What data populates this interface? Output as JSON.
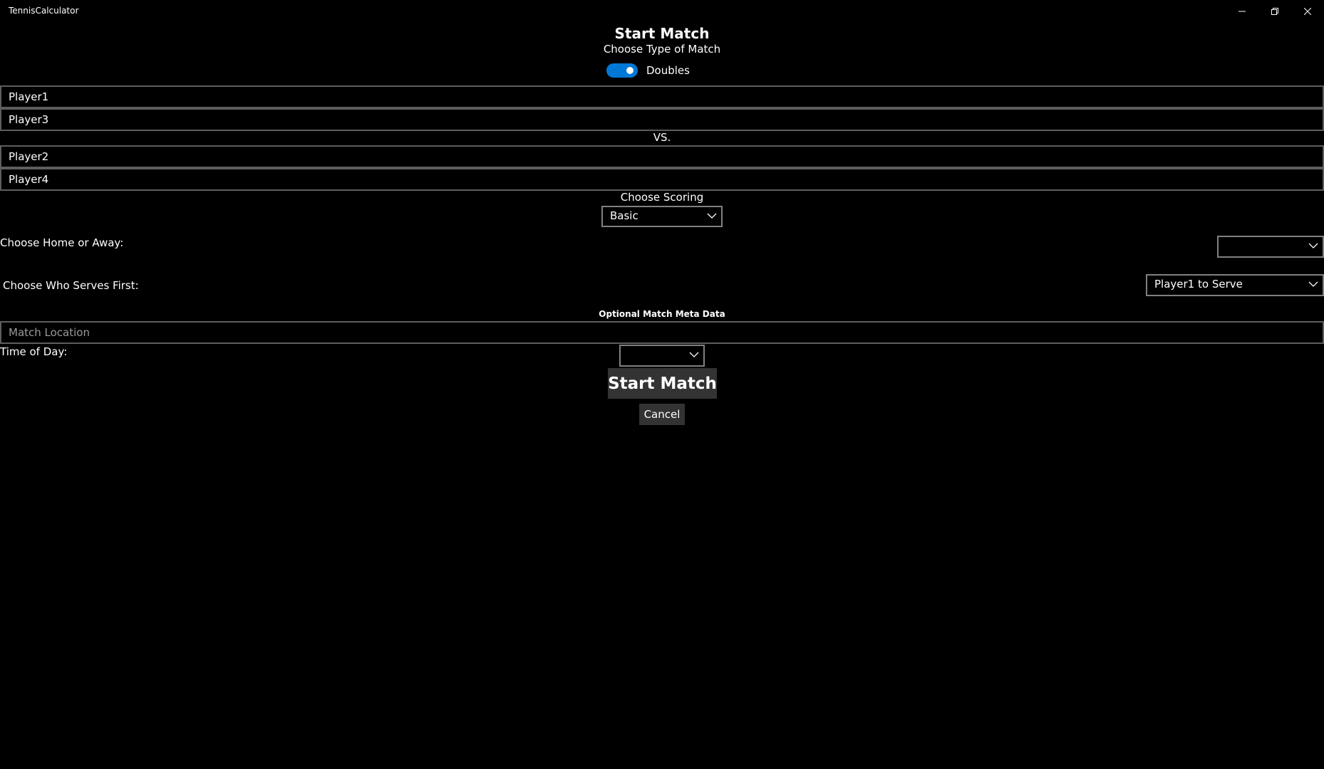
{
  "window": {
    "app_title": "TennisCalculator"
  },
  "header": {
    "title": "Start Match",
    "subtitle": "Choose Type of Match",
    "match_type_toggle": {
      "label": "Doubles",
      "state": "on",
      "accent_color": "#0078d7"
    }
  },
  "players": {
    "team1": [
      "Player1",
      "Player3"
    ],
    "vs_label": "VS.",
    "team2": [
      "Player2",
      "Player4"
    ]
  },
  "scoring": {
    "label": "Choose Scoring",
    "selected": "Basic"
  },
  "home_away": {
    "label": "Choose Home or Away:",
    "selected": ""
  },
  "serve_first": {
    "label": "Choose Who Serves First:",
    "selected": "Player1 to Serve"
  },
  "meta": {
    "title": "Optional Match Meta Data",
    "location_placeholder": "Match Location",
    "time_of_day_label": "Time of Day:",
    "time_of_day_selected": ""
  },
  "actions": {
    "start_label": "Start Match",
    "cancel_label": "Cancel"
  },
  "icons": {
    "minimize": "minimize-icon",
    "restore": "restore-icon",
    "close": "close-icon",
    "dropdown": "chevron-down-icon"
  }
}
